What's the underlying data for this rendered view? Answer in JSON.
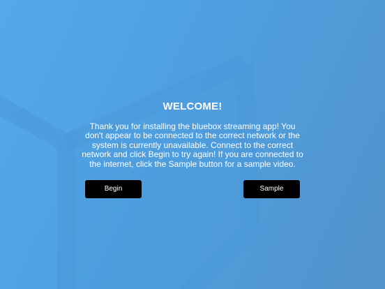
{
  "welcome": {
    "title": "WELCOME!",
    "message": "Thank you for installing the bluebox streaming app! You don't appear to be connected to the correct network or the system is currently unavailable. Connect to the correct network and click Begin to try again! If you are connected to the internet, click the Sample button for a sample video."
  },
  "buttons": {
    "begin_label": "Begin",
    "sample_label": "Sample"
  },
  "colors": {
    "background_primary": "#55a9ea",
    "background_secondary": "#5293cb",
    "button_background": "#000000",
    "text": "#ffffff"
  }
}
